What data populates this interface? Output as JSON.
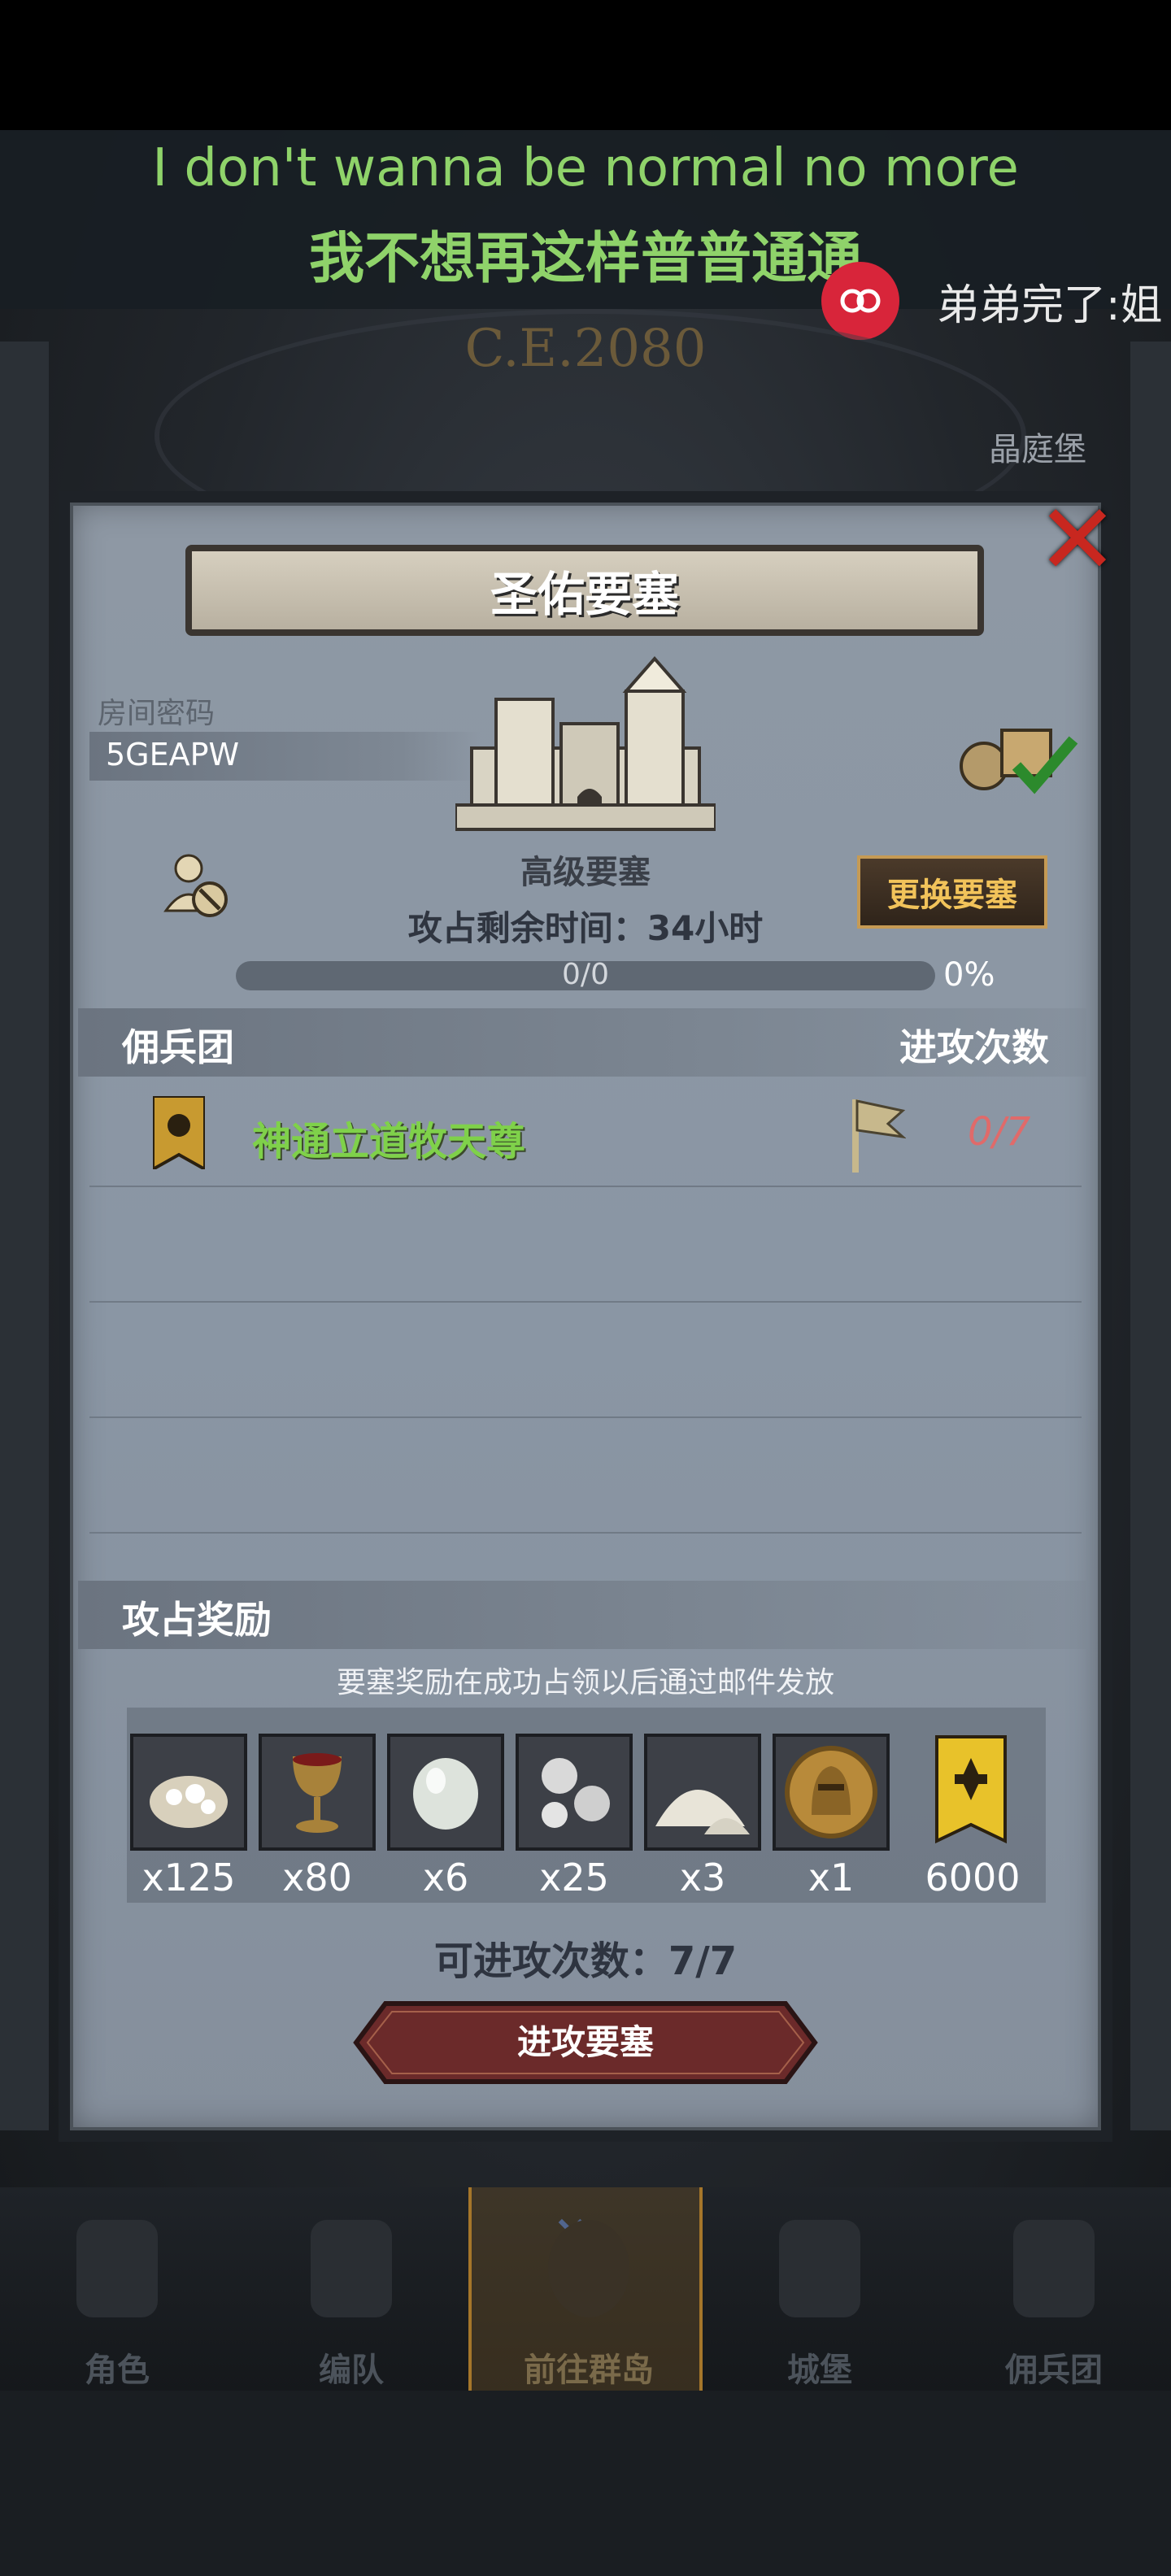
{
  "overlay": {
    "lyric_en": "I don't wanna be normal no more",
    "lyric_zh": "我不想再这样普普通通",
    "danmu_text": "弟弟完了:姐"
  },
  "background": {
    "era": "C.E.2080",
    "location": "晶庭堡"
  },
  "dialog": {
    "title": "圣佑要塞",
    "room_label": "房间密码",
    "room_code": "5GEAPW",
    "fortress_tier": "高级要塞",
    "change_button": "更换要塞",
    "time_left": "攻占剩余时间：34小时",
    "progress_text": "0/0",
    "progress_percent": "0%",
    "progress_fraction": 0,
    "mercenary_header": "佣兵团",
    "attacks_header": "进攻次数",
    "mercenaries": [
      {
        "name": "神通立道牧天尊",
        "count": "0/7"
      }
    ],
    "reward_header": "攻占奖励",
    "reward_note": "要塞奖励在成功占领以后通过邮件发放",
    "rewards": [
      {
        "icon": "ore-sack-icon",
        "qty": "x125"
      },
      {
        "icon": "goblet-icon",
        "qty": "x80"
      },
      {
        "icon": "gem-icon",
        "qty": "x6"
      },
      {
        "icon": "silver-stones-icon",
        "qty": "x25"
      },
      {
        "icon": "salt-pile-icon",
        "qty": "x3"
      },
      {
        "icon": "knight-medal-icon",
        "qty": "x1"
      },
      {
        "icon": "guild-banner-icon",
        "qty": "6000"
      }
    ],
    "attempts": "可进攻次数：7/7",
    "attack_button": "进攻要塞"
  },
  "nav": {
    "items": [
      {
        "label": "角色"
      },
      {
        "label": "编队"
      },
      {
        "label": "前往群岛"
      },
      {
        "label": "城堡"
      },
      {
        "label": "佣兵团"
      }
    ]
  },
  "colors": {
    "lyric": "#8fd36a",
    "merc_name": "#7fd14a",
    "merc_count": "#e06a6a",
    "change_button_text": "#f2c35a",
    "close": "#c8271f"
  }
}
